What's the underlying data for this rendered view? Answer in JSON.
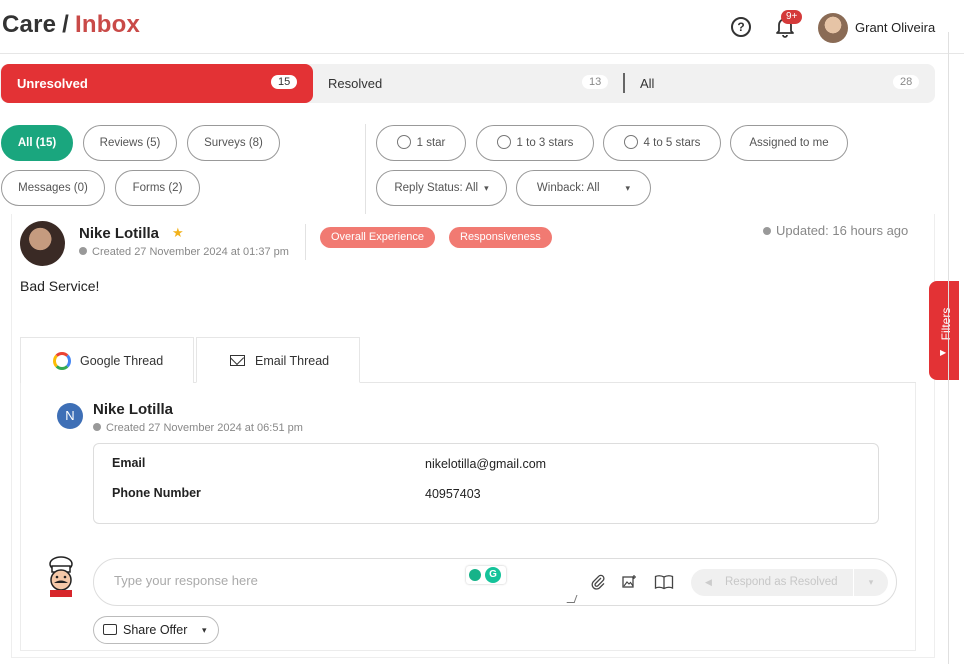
{
  "header": {
    "brand_care": "Care",
    "brand_sep": "/",
    "brand_inbox": "Inbox",
    "help_icon": "question-circle-icon",
    "notif_badge": "9+",
    "user_name": "Grant Oliveira"
  },
  "status_tabs": [
    {
      "label": "Unresolved",
      "count": "15"
    },
    {
      "label": "Resolved",
      "count": "13"
    },
    {
      "label": "All",
      "count": "28"
    }
  ],
  "filters": {
    "all": "All (15)",
    "reviews": "Reviews (5)",
    "surveys": "Surveys (8)",
    "messages": "Messages (0)",
    "forms": "Forms (2)",
    "one_star": "1 star",
    "one_to_three": "1 to 3 stars",
    "four_to_five": "4 to 5 stars",
    "assigned": "Assigned to me",
    "reply_status": "Reply Status: All",
    "winback": "Winback: All"
  },
  "review": {
    "name": "Nike Lotilla",
    "created": "Created 27 November 2024 at 01:37 pm",
    "tags": [
      "Overall Experience",
      "Responsiveness"
    ],
    "updated": "Updated: 16 hours ago",
    "text": "Bad Service!"
  },
  "thread_tabs": {
    "google": "Google Thread",
    "email": "Email Thread"
  },
  "thread": {
    "initial": "N",
    "name": "Nike Lotilla",
    "created": "Created 27 November 2024 at 06:51 pm",
    "email_label": "Email",
    "email_value": "nikelotilla@gmail.com",
    "phone_label": "Phone Number",
    "phone_value": "40957403"
  },
  "response": {
    "placeholder": "Type your response here",
    "grammarly_letter": "G",
    "respond_label": "Respond as Resolved",
    "share_offer": "Share Offer"
  },
  "side": {
    "filters": "Filters"
  },
  "colors": {
    "accent_red": "#e33235",
    "inbox_red": "#c94a48",
    "active_green": "#1aa67e",
    "tag_salmon": "#f17a72"
  }
}
